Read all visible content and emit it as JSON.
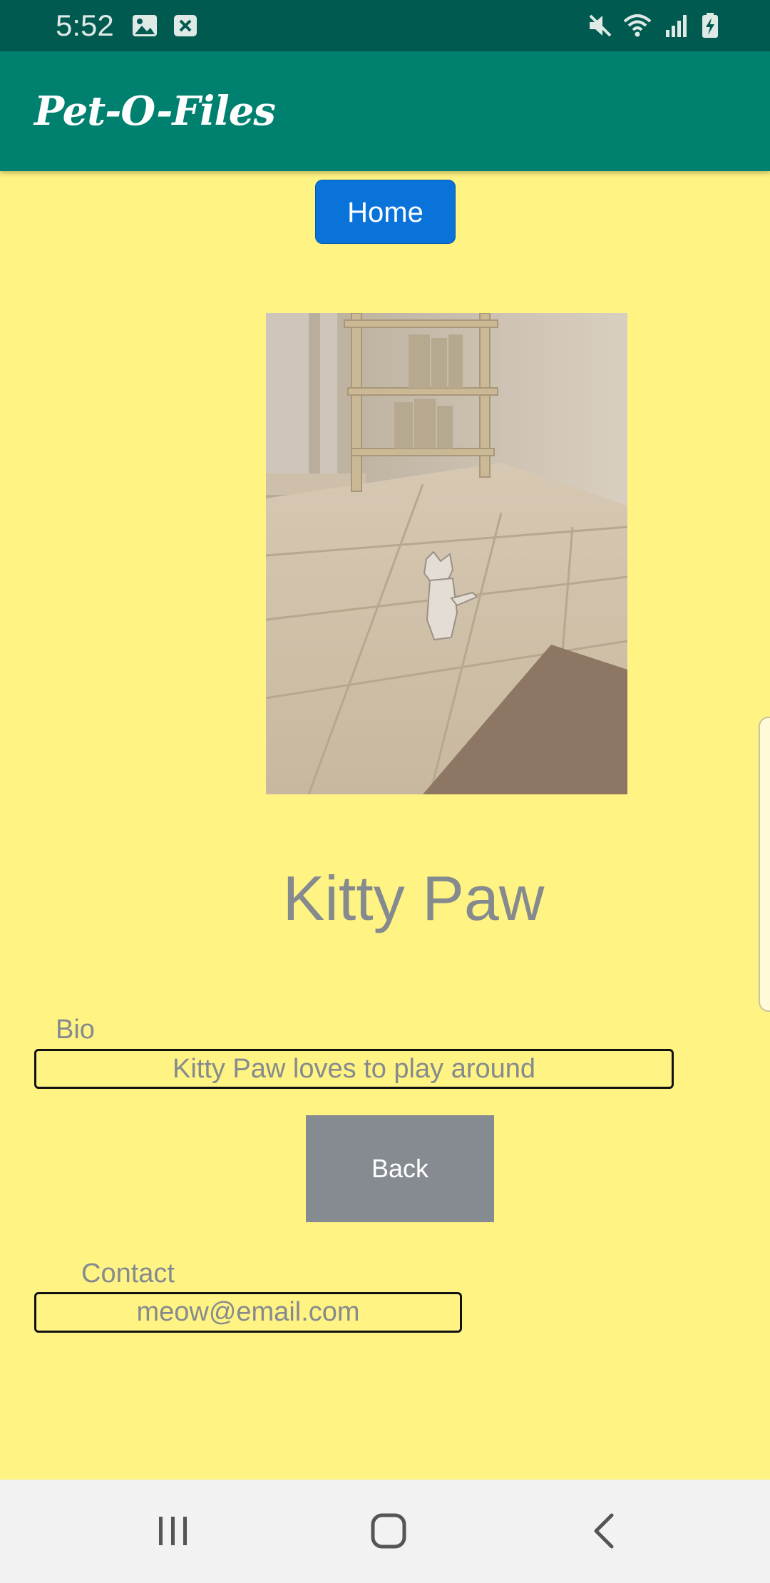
{
  "status_bar": {
    "time": "5:52",
    "icons": [
      "image-icon",
      "close-box-icon",
      "mute-icon",
      "wifi-icon",
      "signal-icon",
      "battery-charging-icon"
    ]
  },
  "app_bar": {
    "title": "Pet-O-Files"
  },
  "home_button": {
    "label": "Home"
  },
  "pet": {
    "photo": "pet-photo",
    "name": "Kitty Paw"
  },
  "bio": {
    "label": "Bio",
    "value": "Kitty Paw loves to play around"
  },
  "back_button": {
    "label": "Back"
  },
  "contact": {
    "label": "Contact",
    "value": "meow@email.com"
  },
  "nav_bar": {
    "icons": [
      "recents-icon",
      "home-icon",
      "back-icon"
    ]
  },
  "colors": {
    "background": "#fff383",
    "status_bar": "#005a4f",
    "app_bar": "#00816f",
    "home_button": "#0a73d9",
    "back_button": "#858b91",
    "text_gray": "#858a8f"
  }
}
